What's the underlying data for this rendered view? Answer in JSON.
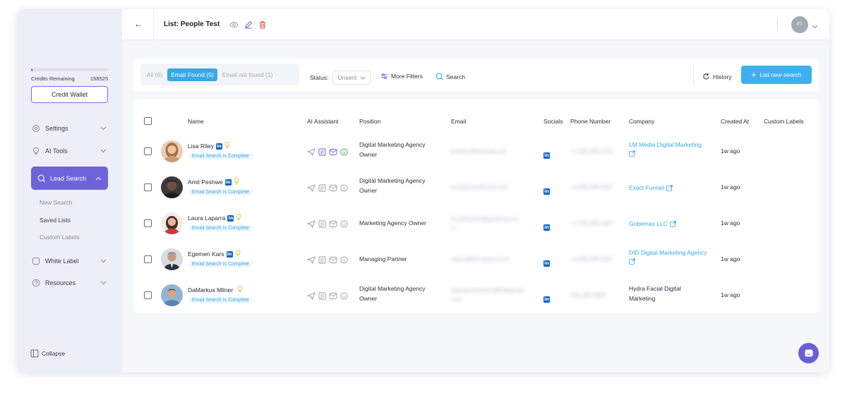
{
  "sidebar": {
    "credits_label": "Credits Remaining",
    "credits_value": "158525",
    "credits_fraction": 0.02,
    "credit_wallet": "Credit Wallet",
    "items": [
      {
        "label": "Settings",
        "icon": "gear-icon"
      },
      {
        "label": "AI Tools",
        "icon": "bulb-icon"
      },
      {
        "label": "Lead Search",
        "icon": "search-icon"
      },
      {
        "label": "White Label",
        "icon": "tag-icon"
      },
      {
        "label": "Resources",
        "icon": "help-icon"
      }
    ],
    "sub_items": [
      "New Search",
      "Saved Lists",
      "Custom Labels"
    ],
    "collapse": "Collapse"
  },
  "header": {
    "title": "List: People Test",
    "avatar_initials": "PT"
  },
  "toolbar": {
    "tabs": [
      "All (6)",
      "Email Found (5)",
      "Email not found (1)"
    ],
    "status_label": "Status:",
    "status_value": "Unsent",
    "more_filters": "More Filters",
    "search": "Search",
    "history": "History",
    "new_search": "List new search"
  },
  "table": {
    "headers": [
      "Name",
      "AI Assistant",
      "Position",
      "Email",
      "Socials",
      "Phone Number",
      "Company",
      "Created At",
      "Custom Labels"
    ],
    "status_badge": "Email Search Is Complete",
    "rows": [
      {
        "name": "Lisa Riley",
        "position_1": "Digital Marketing Agency",
        "position_2": "Owner",
        "email_1": "lisariley@lmmedia.net",
        "email_2": "",
        "phone": "+1 555-488-4721",
        "company_1": "LM Media Digital Marketing",
        "company_2": "",
        "company_link": true,
        "created": "1w ago",
        "linkedin": true
      },
      {
        "name": "Amit Peshwe",
        "position_1": "Digital Marketing Agency",
        "position_2": "Owner",
        "email_1": "amit@exactfunnel.com",
        "email_2": "",
        "phone": "+1 555-488-4327",
        "company_1": "Exact Funnel",
        "company_2": "",
        "company_link": true,
        "created": "1w ago",
        "linkedin": true
      },
      {
        "name": "Laura Laparra",
        "position_1": "Marketing Agency Owner",
        "position_2": "",
        "email_1": "lauralaparra@gobemax.co",
        "email_2": "m",
        "phone": "+1 555-488-4337",
        "company_1": "Gobemax LLC",
        "company_2": "",
        "company_link": true,
        "created": "1w ago",
        "linkedin": true
      },
      {
        "name": "Egemen Kars",
        "position_1": "Managing Partner",
        "position_2": "",
        "email_1": "ekars@did-agency.com",
        "email_2": "",
        "phone": "+1 555-488-4327",
        "company_1": "DID Digital Marketing Agency",
        "company_2": "",
        "company_link": true,
        "created": "1w ago",
        "linkedin": true
      },
      {
        "name": "DaMarkus Milner",
        "position_1": "Digital Marketing Agency",
        "position_2": "Owner",
        "email_1": "damarkusmilner1983@gmail.",
        "email_2": "com",
        "phone": "555-280-8990",
        "company_1": "Hydra Facial Digital",
        "company_2": "Marketing",
        "company_link": false,
        "created": "1w ago",
        "linkedin": false
      }
    ]
  }
}
